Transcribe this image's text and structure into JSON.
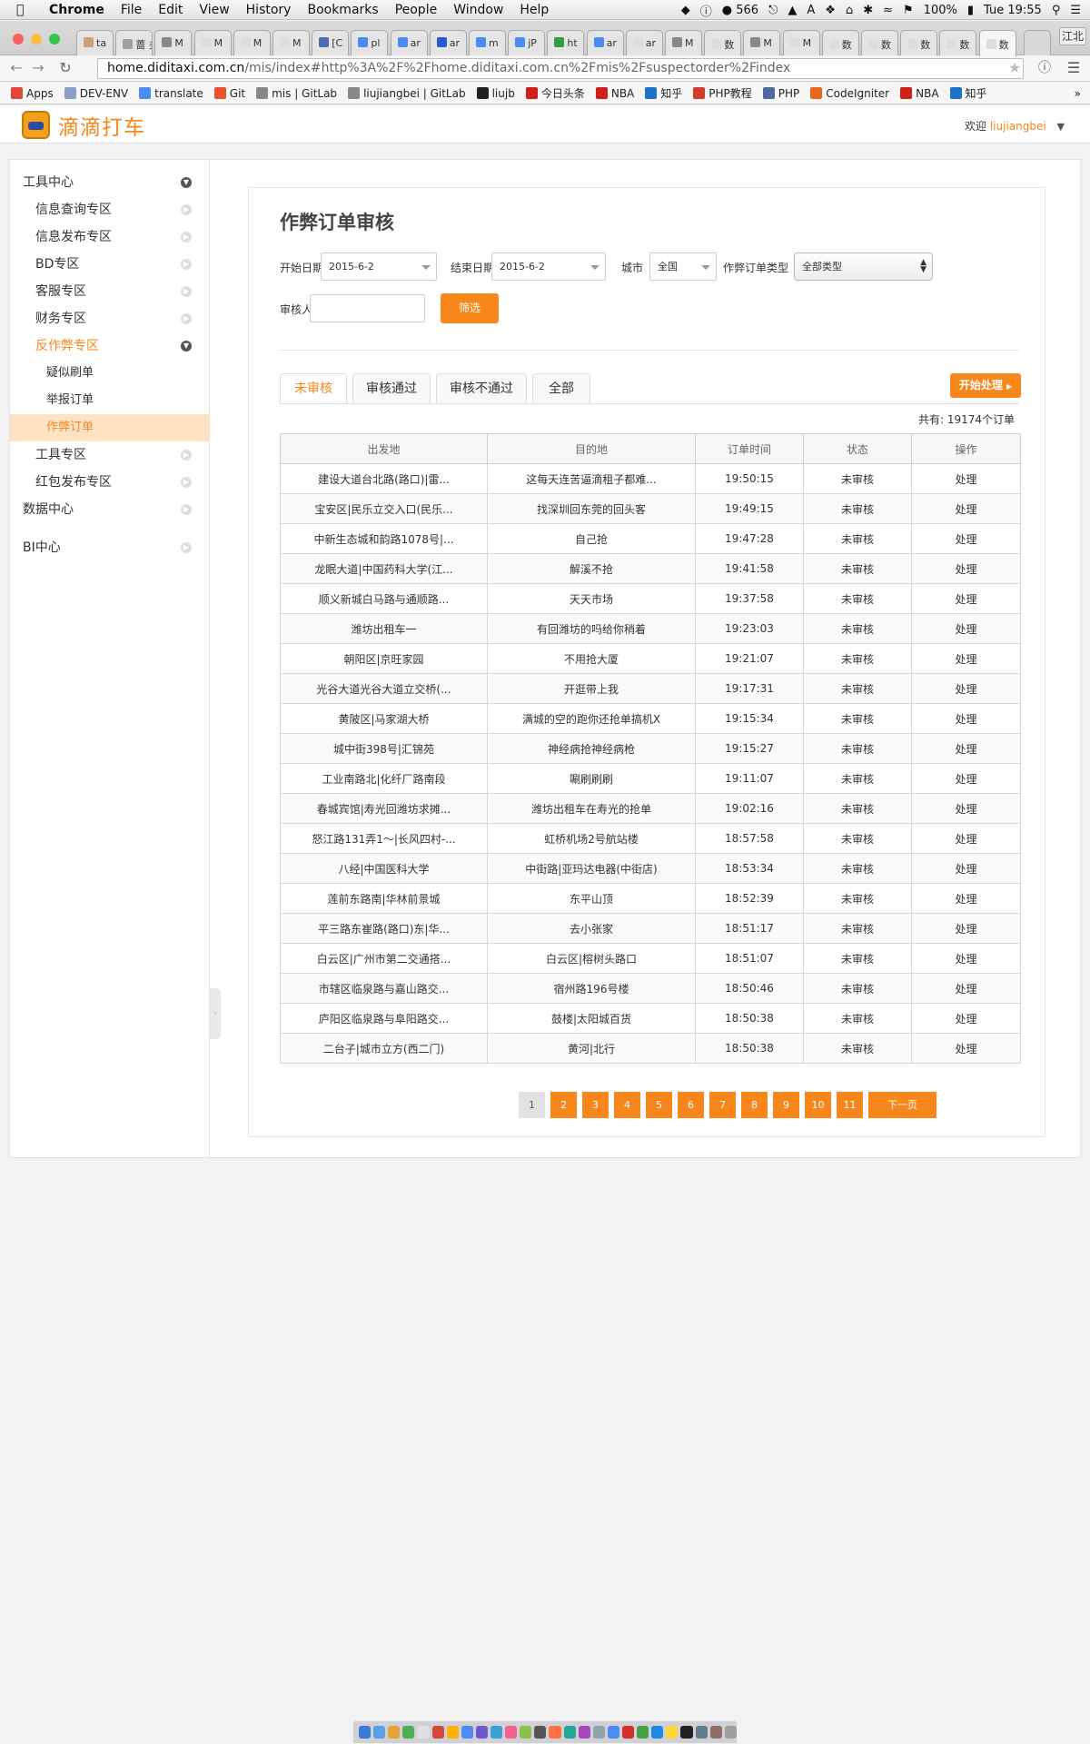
{
  "os_menubar": {
    "app": "Chrome",
    "menus": [
      "File",
      "Edit",
      "View",
      "History",
      "Bookmarks",
      "People",
      "Window",
      "Help"
    ],
    "status": {
      "badge_count": "566",
      "battery": "100%",
      "clock": "Tue 19:55"
    }
  },
  "browser": {
    "tabs": [
      "ta",
      "蔷 多",
      "M",
      "M",
      "M",
      "M",
      "[C",
      "pl",
      "ar",
      "ar",
      "m",
      "jP",
      "ht",
      "ar",
      "ar",
      "M",
      "数",
      "M",
      "M",
      "数",
      "数",
      "数",
      "数",
      "数"
    ],
    "profile_button": "江北",
    "url_host": "home.diditaxi.com.cn",
    "url_path": "/mis/index#http%3A%2F%2Fhome.diditaxi.com.cn%2Fmis%2Fsuspectorder%2Findex",
    "bookmarks": [
      "Apps",
      "DEV-ENV",
      "translate",
      "Git",
      "mis | GitLab",
      "liujiangbei | GitLab",
      "liujb",
      "今日头条",
      "NBA",
      "知乎",
      "PHP教程",
      "PHP",
      "CodeIgniter",
      "NBA",
      "知乎"
    ],
    "bookmarks_overflow": "»"
  },
  "header": {
    "logo_text": "滴滴打车",
    "welcome_label": "欢迎",
    "username": "liujiangbei"
  },
  "sidebar": {
    "items": [
      {
        "label": "工具中心",
        "level": "top",
        "state": "expanded"
      },
      {
        "label": "信息查询专区",
        "level": "section",
        "state": "collapsed"
      },
      {
        "label": "信息发布专区",
        "level": "section",
        "state": "collapsed"
      },
      {
        "label": "BD专区",
        "level": "section",
        "state": "collapsed"
      },
      {
        "label": "客服专区",
        "level": "section",
        "state": "collapsed"
      },
      {
        "label": "财务专区",
        "level": "section",
        "state": "collapsed"
      },
      {
        "label": "反作弊专区",
        "level": "section",
        "state": "expanded-active"
      },
      {
        "label": "疑似刷单",
        "level": "sub",
        "state": "normal"
      },
      {
        "label": "举报订单",
        "level": "sub",
        "state": "normal"
      },
      {
        "label": "作弊订单",
        "level": "sub",
        "state": "current"
      },
      {
        "label": "工具专区",
        "level": "section",
        "state": "collapsed"
      },
      {
        "label": "红包发布专区",
        "level": "section",
        "state": "collapsed"
      },
      {
        "label": "数据中心",
        "level": "top",
        "state": "collapsed"
      },
      {
        "label": "BI中心",
        "level": "top",
        "state": "collapsed"
      }
    ],
    "collapse_handle": "‹"
  },
  "main": {
    "title": "作弊订单审核",
    "filters": {
      "start_date_label": "开始日期",
      "start_date_value": "2015-6-2",
      "end_date_label": "结束日期",
      "end_date_value": "2015-6-2",
      "city_label": "城市",
      "city_value": "全国",
      "type_label": "作弊订单类型",
      "type_value": "全部类型",
      "reviewer_label": "审核人",
      "reviewer_value": "",
      "filter_button": "筛选"
    },
    "tabs": [
      "未审核",
      "审核通过",
      "审核不通过",
      "全部"
    ],
    "active_tab": "未审核",
    "start_button": "开始处理",
    "total_label": "共有:",
    "total_value": "19174个订单",
    "table": {
      "columns": [
        "出发地",
        "目的地",
        "订单时间",
        "状态",
        "操作"
      ],
      "rows": [
        [
          "建设大道台北路(路口)|雷...",
          "这每天连苦逼滴租子都难...",
          "19:50:15",
          "未审核",
          "处理"
        ],
        [
          "宝安区|民乐立交入口(民乐...",
          "找深圳回东莞的回头客",
          "19:49:15",
          "未审核",
          "处理"
        ],
        [
          "中新生态城和韵路1078号|...",
          "自己抢",
          "19:47:28",
          "未审核",
          "处理"
        ],
        [
          "龙眠大道|中国药科大学(江...",
          "解溪不抢",
          "19:41:58",
          "未审核",
          "处理"
        ],
        [
          "顺义新城白马路与通顺路...",
          "天天市场",
          "19:37:58",
          "未审核",
          "处理"
        ],
        [
          "潍坊出租车一",
          "有回潍坊的吗给你稍着",
          "19:23:03",
          "未审核",
          "处理"
        ],
        [
          "朝阳区|京旺家园",
          "不用抢大厦",
          "19:21:07",
          "未审核",
          "处理"
        ],
        [
          "光谷大道光谷大道立交桥(...",
          "开逛带上我",
          "19:17:31",
          "未审核",
          "处理"
        ],
        [
          "黄陂区|马家湖大桥",
          "满城的空的跑你还抢单搞机X",
          "19:15:34",
          "未审核",
          "处理"
        ],
        [
          "城中街398号|汇锦苑",
          "神经病抢神经病枪",
          "19:15:27",
          "未审核",
          "处理"
        ],
        [
          "工业南路北|化纤厂路南段",
          "唰刷刷刷",
          "19:11:07",
          "未审核",
          "处理"
        ],
        [
          "春城宾馆|寿光回潍坊求摊...",
          "潍坊出租车在寿光的抢单",
          "19:02:16",
          "未审核",
          "处理"
        ],
        [
          "怒江路131弄1～|长风四村-...",
          "虹桥机场2号航站楼",
          "18:57:58",
          "未审核",
          "处理"
        ],
        [
          "八经|中国医科大学",
          "中街路|亚玛达电器(中街店)",
          "18:53:34",
          "未审核",
          "处理"
        ],
        [
          "莲前东路南|华林前景城",
          "东平山顶",
          "18:52:39",
          "未审核",
          "处理"
        ],
        [
          "平三路东崔路(路口)东|华...",
          "去小张家",
          "18:51:17",
          "未审核",
          "处理"
        ],
        [
          "白云区|广州市第二交通搭...",
          "白云区|榕树头路口",
          "18:51:07",
          "未审核",
          "处理"
        ],
        [
          "市辖区临泉路与嘉山路交...",
          "宿州路196号楼",
          "18:50:46",
          "未审核",
          "处理"
        ],
        [
          "庐阳区临泉路与阜阳路交...",
          "鼓楼|太阳城百货",
          "18:50:38",
          "未审核",
          "处理"
        ],
        [
          "二台子|城市立方(西二门)",
          "黄河|北行",
          "18:50:38",
          "未审核",
          "处理"
        ]
      ]
    },
    "pagination": {
      "pages": [
        "1",
        "2",
        "3",
        "4",
        "5",
        "6",
        "7",
        "8",
        "9",
        "10",
        "11"
      ],
      "current": "1",
      "next_label": "下一页"
    }
  },
  "colors": {
    "accent": "#f7861b",
    "sidebar_current_bg": "#fde3c4"
  }
}
